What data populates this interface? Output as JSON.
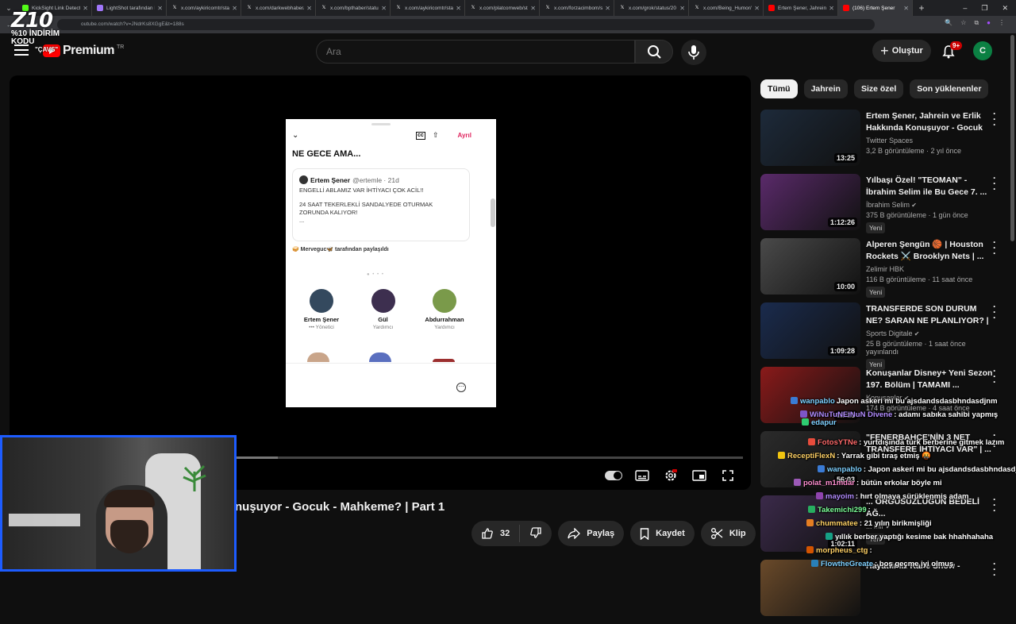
{
  "browser": {
    "tabs": [
      {
        "title": "KickSight Link Detecto",
        "icon": "kicksight-icon",
        "color": "#53fc18"
      },
      {
        "title": "LightShot tarafından E",
        "icon": "lightshot-icon",
        "color": "#a076f9"
      },
      {
        "title": "x.com/aykiricomtr/stat",
        "icon": "x-icon",
        "color": "#ffffff"
      },
      {
        "title": "x.com/darkwebhaber/st",
        "icon": "x-icon",
        "color": "#ffffff"
      },
      {
        "title": "x.com/bpthaber/statu",
        "icon": "x-icon",
        "color": "#ffffff"
      },
      {
        "title": "x.com/aykiricomtr/stat",
        "icon": "x-icon",
        "color": "#ffffff"
      },
      {
        "title": "x.com/platcomweb/sta",
        "icon": "x-icon",
        "color": "#ffffff"
      },
      {
        "title": "x.com/forzacimbom/s",
        "icon": "x-icon",
        "color": "#ffffff"
      },
      {
        "title": "x.com/grok/status/20",
        "icon": "x-icon",
        "color": "#ffffff"
      },
      {
        "title": "x.com/Being_Humor/s",
        "icon": "x-icon",
        "color": "#ffffff"
      },
      {
        "title": "Ertem Şener, Jahrein v",
        "icon": "youtube-icon",
        "color": "#ff0000"
      },
      {
        "title": "(106) Ertem Şener",
        "icon": "youtube-icon",
        "color": "#ff0000",
        "active": true
      }
    ],
    "url": "outube.com/watch?v=JNdrKs8XGgE&t=188s"
  },
  "overlay": {
    "big": "Z10",
    "line2": "%10 İNDİRİM KODU",
    "line3": "\"ÇAVS\""
  },
  "header": {
    "logo_text": "Premium",
    "region": "TR",
    "search_placeholder": "Ara",
    "create_label": "Oluştur",
    "notif_count": "9+",
    "avatar_letter": "C"
  },
  "embed": {
    "leave_label": "Ayrıl",
    "space_title": "NE GECE AMA...",
    "tweet": {
      "author": "Ertem Şener",
      "handle": "@ertemle · 21d",
      "line1": "ENGELLİ ABLAMIZ VAR İHTİYACI ÇOK ACİL!!",
      "line2": "24 SAAT TEKERLEKLİ SANDALYEDE OTURMAK ZORUNDA KALIYOR!",
      "line3": "..."
    },
    "shared_by": "🥪 Merveguc🦋 tarafından paylaşıldı",
    "speakers": [
      {
        "name": "Ertem Şener",
        "role": "••• Yönetici",
        "color": "#34495e"
      },
      {
        "name": "Gül",
        "role": "Yardımcı",
        "color": "#3d2f4f"
      },
      {
        "name": "Abdurrahman",
        "role": "Yardımcı",
        "color": "#7a9a4a"
      }
    ]
  },
  "player": {
    "progress_fraction": 0.085
  },
  "video": {
    "title": "nuşuyor - Gocuk - Mahkeme? | Part 1",
    "likes": "32",
    "share_label": "Paylaş",
    "save_label": "Kaydet",
    "clip_label": "Klip"
  },
  "chips": [
    "Tümü",
    "Jahrein",
    "Size özel",
    "Son yüklenenler"
  ],
  "recommendations": [
    {
      "title": "Ertem Şener, Jahrein ve Erlik Hakkında Konuşuyor - Gocuk -...",
      "channel": "Twitter Spaces",
      "verified": false,
      "views": "3,2 B görüntüleme · 2 yıl önce",
      "duration": "13:25",
      "badge": "",
      "thumb": "#1d2a3a"
    },
    {
      "title": "Yılbaşı Özel! \"TEOMAN\" - İbrahim Selim ile Bu Gece 7. ...",
      "channel": "İbrahim Selim",
      "verified": true,
      "views": "375 B görüntüleme · 1 gün önce",
      "duration": "1:12:26",
      "badge": "Yeni",
      "thumb": "#5a2a6a"
    },
    {
      "title": "Alperen Şengün 🏀 | Houston Rockets ⚔️ Brooklyn Nets | ...",
      "channel": "Zelimir HBK",
      "verified": false,
      "views": "116 B görüntüleme · 11 saat önce",
      "duration": "10:00",
      "badge": "Yeni",
      "thumb": "#4a4a4a"
    },
    {
      "title": "TRANSFERDE SON DURUM NE? SARAN NE PLANLIYOR? | ...",
      "channel": "Sports Digitale",
      "verified": true,
      "views": "25 B görüntüleme · 1 saat önce yayınlandı",
      "duration": "1:09:28",
      "badge": "Yeni",
      "thumb": "#1a2b4d"
    },
    {
      "title": "Konuşanlar Disney+ Yeni Sezon 197. Bölüm | TAMAMI ...",
      "channel": "Konuşanlar",
      "verified": true,
      "views": "174 B görüntüleme · 4 saat önce",
      "duration": "32:21",
      "badge": "",
      "thumb": "#8a1a1a"
    },
    {
      "title": "\"FENERBAHÇE'NİN 3 NET TRANSFERE İHTİYACI VAR\" | ...",
      "channel": "",
      "verified": false,
      "views": "",
      "duration": "56:03",
      "badge": "",
      "thumb": "#2b2b2b"
    },
    {
      "title": "... ÖRGÜSÜZLÜĞÜN BEDELİ AĞ...",
      "channel": "... mir",
      "verified": true,
      "views": "",
      "duration": "1:02:11",
      "badge": "Yeni",
      "thumb": "#3b2a4a"
    },
    {
      "title": "Hayattimiz Kane Show -",
      "channel": "",
      "verified": false,
      "views": "",
      "duration": "",
      "badge": "",
      "thumb": "#6a4a2a"
    }
  ],
  "chat": [
    {
      "user": "wanpablo",
      "text": "Japon askeri mi bu ajsdandsdasbhndasdjnm",
      "color": "#7fd1ff",
      "icon": "#3a7bd5"
    },
    {
      "user": "WiNuTuNEiNuN Divene",
      "text": ": adamı sabıka sahibi yapmış",
      "color": "#b28cff",
      "icon": "#7d55c7"
    },
    {
      "user": "edapur",
      "text": "",
      "color": "#7fd1ff",
      "icon": "#2ecc71"
    },
    {
      "user": "FotosYTNe",
      "text": ": yurtdışında türk berberine gitmek lazım",
      "color": "#ff6b6b",
      "icon": "#e74c3c"
    },
    {
      "user": "ReceptiFlexN",
      "text": ": Yarrak gibi tıraş etmiş 🤬",
      "color": "#ffd166",
      "icon": "#f1c40f"
    },
    {
      "user": "wanpablo",
      "text": ": Japon askeri mi bu ajsdandsdasbhndasdjnm",
      "color": "#7fd1ff",
      "icon": "#3a7bd5"
    },
    {
      "user": "polat_m1mdar",
      "text": ": bütün erkolar böyle mi",
      "color": "#ff8fd1",
      "icon": "#9b59b6"
    },
    {
      "user": "mayoim",
      "text": ": hırt olmaya sürüklenmiş adam",
      "color": "#b28cff",
      "icon": "#8e44ad"
    },
    {
      "user": "Takemichi299",
      "text": ": ",
      "color": "#7dff9a",
      "icon": "#27ae60"
    },
    {
      "user": "chummatee",
      "text": ": 21 yılın birikmişliği",
      "color": "#ffd166",
      "icon": "#e67e22"
    },
    {
      "user": "",
      "text": "yıllık berber yaptığı kesime bak hhahhahaha",
      "color": "#ffffff",
      "icon": "#16a085"
    },
    {
      "user": "morpheus_ctg",
      "text": ":",
      "color": "#ffd166",
      "icon": "#d35400"
    },
    {
      "user": "FlowtheGreate",
      "text": ": boş geçme iyi olmuş",
      "color": "#7fd1ff",
      "icon": "#2980b9"
    }
  ],
  "colors": {
    "bg": "#0f0f0f",
    "accent": "#ff0000",
    "webcam_border": "#1d5cff"
  }
}
